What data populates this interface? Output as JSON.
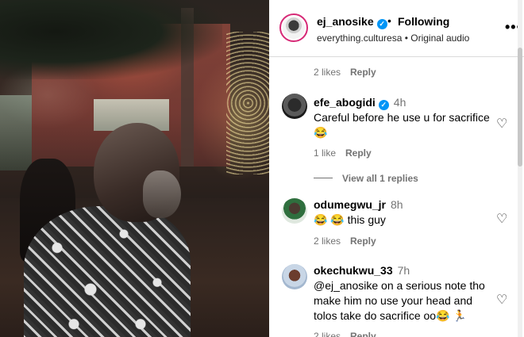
{
  "post": {
    "username": "ej_anosike",
    "separator": "•",
    "follow_status": "Following",
    "source": "everything.culturesa • Original audio",
    "more_icon": "more-horizontal-icon"
  },
  "top_meta": {
    "likes": "2 likes",
    "reply": "Reply"
  },
  "comments": [
    {
      "username": "efe_abogidi",
      "time": "4h",
      "text": "Careful before he use u for sacrifice 😂",
      "likes": "1 like",
      "reply": "Reply",
      "view_replies": "View all 1 replies"
    },
    {
      "username": "odumegwu_jr",
      "time": "8h",
      "text": "😂 😂 this guy",
      "likes": "2 likes",
      "reply": "Reply"
    },
    {
      "username": "okechukwu_33",
      "time": "7h",
      "text": "@ej_anosike on a serious note tho make him no use your head and tolos take do sacrifice oo😂 🏃",
      "likes": "2 likes",
      "reply": "Reply"
    }
  ],
  "colors": {
    "verified": "#0095f6",
    "secondary_text": "#737373",
    "ring": "#d62976"
  },
  "icons": {
    "verified": "verified-badge-icon",
    "heart": "heart-outline-icon"
  }
}
